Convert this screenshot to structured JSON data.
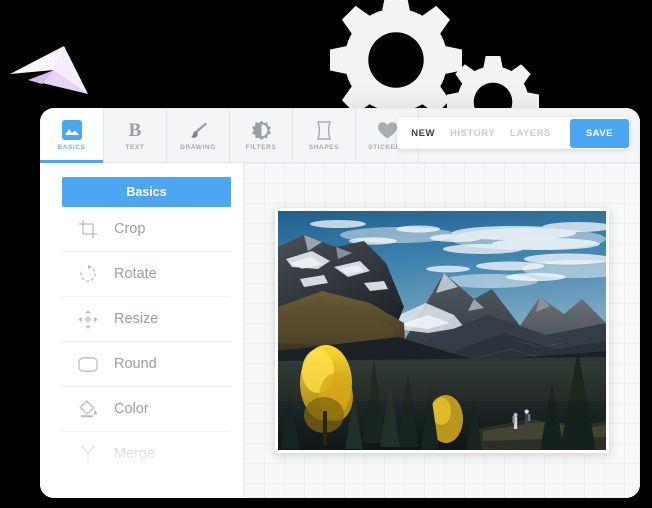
{
  "decor": {
    "gear_large": "gear-icon",
    "gear_small": "gear-icon",
    "paper_plane": "paper-plane-icon",
    "plane_color": "#e6d4f2",
    "gear_color": "#f2f3f5"
  },
  "theme": {
    "accent": "#4ca6f2",
    "background": "#000000",
    "window_bg": "#ffffff",
    "tabbar_bg": "#f4f5f7",
    "canvas_bg": "#f6f8fa",
    "muted_text": "#9aa0a8",
    "disabled_text": "#d6d9dd"
  },
  "tabs": [
    {
      "label": "BASICS",
      "icon": "image-icon",
      "active": true
    },
    {
      "label": "TEXT",
      "icon": "letter-b-icon",
      "active": false
    },
    {
      "label": "DRAWING",
      "icon": "brush-icon",
      "active": false
    },
    {
      "label": "FILTERS",
      "icon": "contrast-icon",
      "active": false
    },
    {
      "label": "SHAPES",
      "icon": "shape-icon",
      "active": false
    },
    {
      "label": "STICKERS",
      "icon": "heart-icon",
      "active": false
    }
  ],
  "actions": {
    "new_label": "NEW",
    "history_label": "HISTORY",
    "layers_label": "LAYERS",
    "save_label": "SAVE"
  },
  "sidebar": {
    "header": "Basics",
    "items": [
      {
        "label": "Crop",
        "icon": "crop-icon",
        "disabled": false
      },
      {
        "label": "Rotate",
        "icon": "rotate-icon",
        "disabled": false
      },
      {
        "label": "Resize",
        "icon": "resize-icon",
        "disabled": false
      },
      {
        "label": "Round",
        "icon": "round-icon",
        "disabled": false
      },
      {
        "label": "Color",
        "icon": "paint-bucket-icon",
        "disabled": false
      },
      {
        "label": "Merge",
        "icon": "merge-icon",
        "disabled": true
      }
    ]
  },
  "canvas": {
    "photo_alt": "mountain-landscape-photo"
  }
}
